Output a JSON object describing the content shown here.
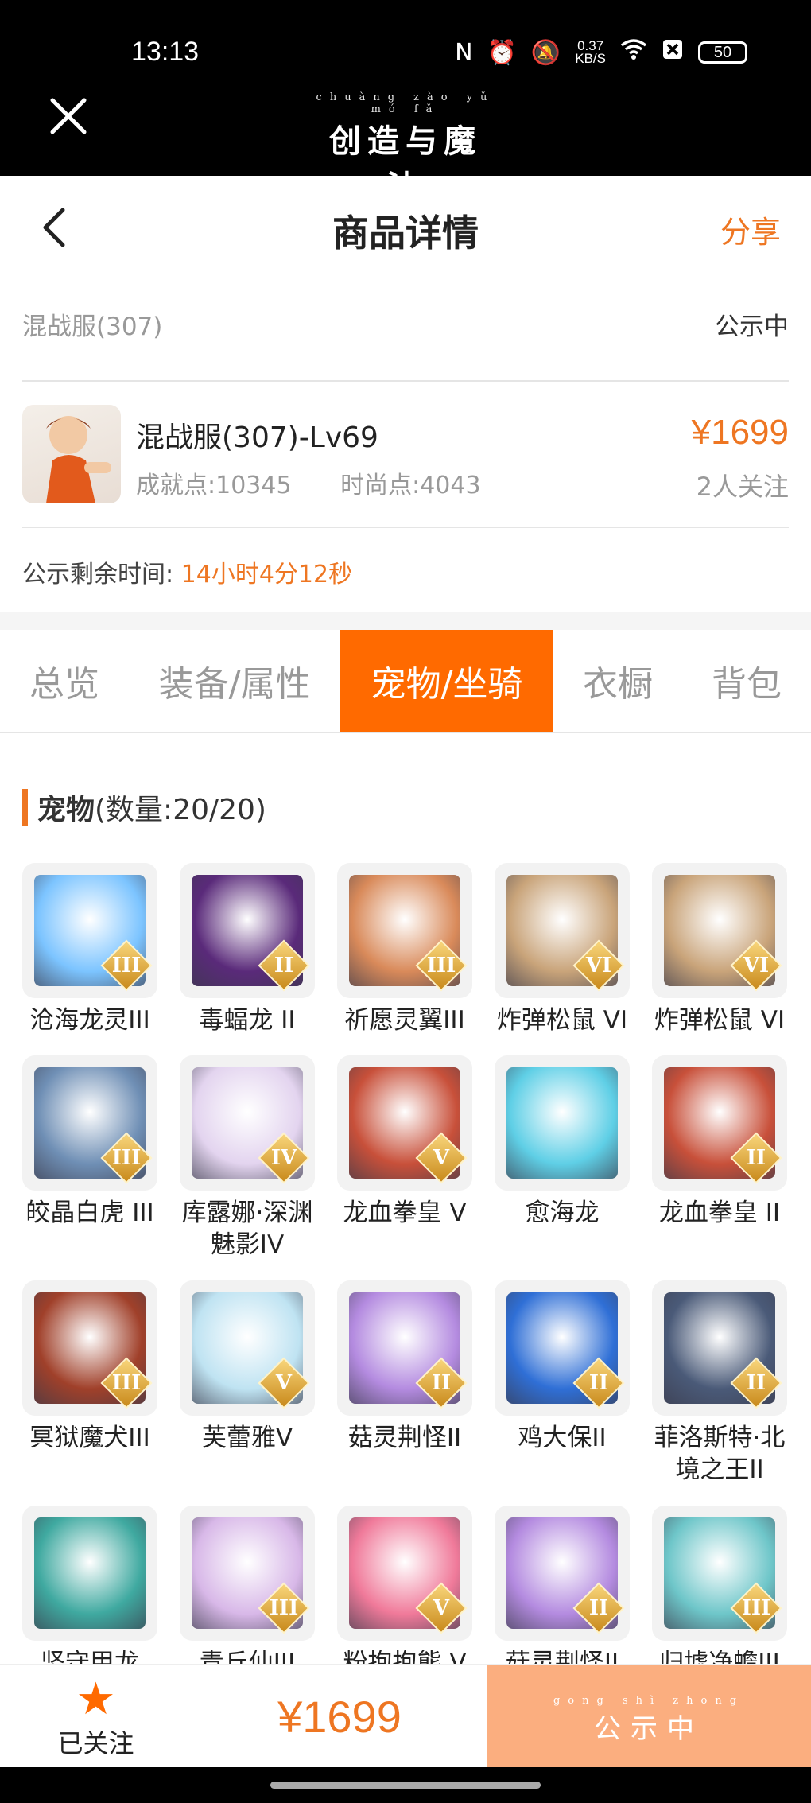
{
  "status_bar": {
    "time": "13:13",
    "net_speed": "0.37",
    "net_unit": "KB/S",
    "battery": "50"
  },
  "app_bar": {
    "logo_pinyin": "chuàng zào yǔ mó fǎ",
    "logo_text": "创造与魔法"
  },
  "header": {
    "title": "商品详情",
    "share_label": "分享"
  },
  "server": {
    "name": "混战服(307)",
    "status": "公示中"
  },
  "product": {
    "name": "混战服(307)-Lv69",
    "achievement": "成就点:10345",
    "fashion": "时尚点:4043",
    "price": "¥1699",
    "followers": "2人关注"
  },
  "remaining": {
    "label": "公示剩余时间:",
    "value": "14小时4分12秒"
  },
  "tabs": [
    "总览",
    "装备/属性",
    "宠物/坐骑",
    "衣橱",
    "背包"
  ],
  "active_tab": "宠物/坐骑",
  "section": {
    "title": "宠物",
    "count": "(数量:20/20)"
  },
  "pets": [
    {
      "name": "沧海龙灵III",
      "rank": "III",
      "color": "#7cc4ff"
    },
    {
      "name": "毒蝠龙 II",
      "rank": "II",
      "color": "#5a2a7a"
    },
    {
      "name": "祈愿灵翼III",
      "rank": "III",
      "color": "#d98a5a"
    },
    {
      "name": "炸弹松鼠 VI",
      "rank": "VI",
      "color": "#c9a47a"
    },
    {
      "name": "炸弹松鼠 VI",
      "rank": "VI",
      "color": "#c9a47a"
    },
    {
      "name": "皎晶白虎 III",
      "rank": "III",
      "color": "#6f8fb5"
    },
    {
      "name": "库露娜·深渊魅影IV",
      "rank": "IV",
      "color": "#e3d4ef"
    },
    {
      "name": "龙血拳皇 V",
      "rank": "V",
      "color": "#c8503a"
    },
    {
      "name": "愈海龙",
      "rank": "",
      "color": "#5fcfe6"
    },
    {
      "name": "龙血拳皇 II",
      "rank": "II",
      "color": "#c8503a"
    },
    {
      "name": "冥狱魔犬III",
      "rank": "III",
      "color": "#a0402a"
    },
    {
      "name": "芙蕾雅V",
      "rank": "V",
      "color": "#bfe3f2"
    },
    {
      "name": "菇灵荆怪II",
      "rank": "II",
      "color": "#b48be0"
    },
    {
      "name": "鸡大保II",
      "rank": "II",
      "color": "#2f6fd6"
    },
    {
      "name": "菲洛斯特·北境之王II",
      "rank": "II",
      "color": "#4a5a78"
    },
    {
      "name": "坚守甲龙",
      "rank": "",
      "color": "#3fa9a0"
    },
    {
      "name": "青丘仙III",
      "rank": "III",
      "color": "#d8b8e8"
    },
    {
      "name": "粉抱抱熊 V",
      "rank": "V",
      "color": "#f07a9a"
    },
    {
      "name": "菇灵荆怪II",
      "rank": "II",
      "color": "#b48be0"
    },
    {
      "name": "归墟净蟾III",
      "rank": "III",
      "color": "#6ec6c9"
    }
  ],
  "bottom_bar": {
    "follow_label": "已关注",
    "price": "¥1699",
    "action_pinyin": "gōng shì zhōng",
    "action_label": "公示中"
  },
  "colors": {
    "accent": "#ee7622",
    "tab_active": "#ff6a00",
    "action_disabled": "#fbae7f"
  }
}
